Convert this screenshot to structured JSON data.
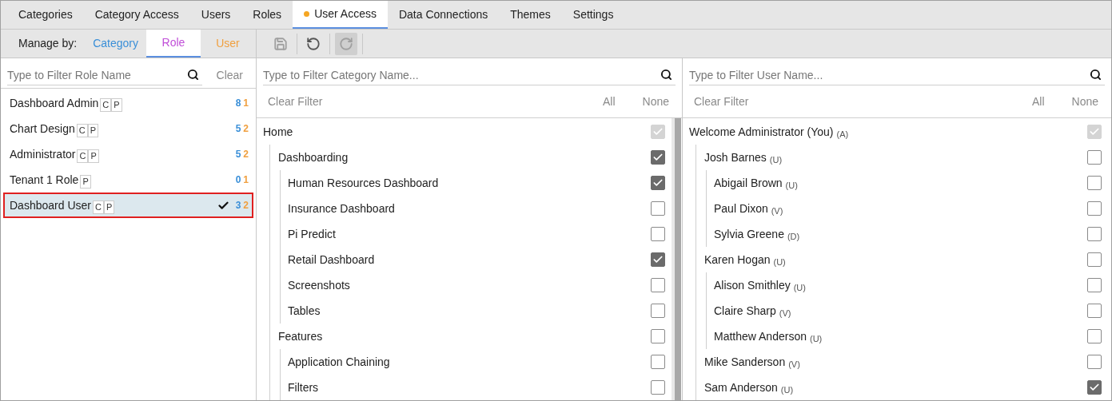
{
  "tabs": [
    {
      "label": "Categories",
      "selected": false,
      "modified": false
    },
    {
      "label": "Category Access",
      "selected": false,
      "modified": false
    },
    {
      "label": "Users",
      "selected": false,
      "modified": false
    },
    {
      "label": "Roles",
      "selected": false,
      "modified": false
    },
    {
      "label": "User Access",
      "selected": true,
      "modified": true
    },
    {
      "label": "Data Connections",
      "selected": false,
      "modified": false
    },
    {
      "label": "Themes",
      "selected": false,
      "modified": false
    },
    {
      "label": "Settings",
      "selected": false,
      "modified": false
    }
  ],
  "manage_by": {
    "label": "Manage by:",
    "options": [
      {
        "label": "Category",
        "selected": false,
        "color": "#3a8fd8"
      },
      {
        "label": "Role",
        "selected": true,
        "color": "#c04fd8"
      },
      {
        "label": "User",
        "selected": false,
        "color": "#f0a040"
      }
    ]
  },
  "toolbar": [
    {
      "kind": "save",
      "disabled": true,
      "pressed": false
    },
    {
      "kind": "undo",
      "disabled": false,
      "pressed": false
    },
    {
      "kind": "redo",
      "disabled": true,
      "pressed": true
    }
  ],
  "roles_panel": {
    "search": {
      "placeholder": "Type to Filter Role Name"
    },
    "clear": "Clear",
    "roles": [
      {
        "name": "Dashboard Admin",
        "badges": [
          "C",
          "P"
        ],
        "count_a": "8",
        "count_b": "1",
        "selected": false
      },
      {
        "name": "Chart Design",
        "badges": [
          "C",
          "P"
        ],
        "count_a": "5",
        "count_b": "2",
        "selected": false
      },
      {
        "name": "Administrator",
        "badges": [
          "C",
          "P"
        ],
        "count_a": "5",
        "count_b": "2",
        "selected": false
      },
      {
        "name": "Tenant 1 Role",
        "badges": [
          "P"
        ],
        "count_a": "0",
        "count_b": "1",
        "selected": false
      },
      {
        "name": "Dashboard User",
        "badges": [
          "C",
          "P"
        ],
        "count_a": "3",
        "count_b": "2",
        "selected": true
      }
    ]
  },
  "categories_panel": {
    "search": {
      "placeholder": "Type to Filter Category Name..."
    },
    "clear_filter": "Clear Filter",
    "all": "All",
    "none": "None",
    "items": [
      {
        "name": "Home",
        "checked": true,
        "disabled": true,
        "children": [
          {
            "name": "Dashboarding",
            "checked": true,
            "disabled": false,
            "children": [
              {
                "name": "Human Resources Dashboard",
                "checked": true,
                "disabled": false
              },
              {
                "name": "Insurance Dashboard",
                "checked": false,
                "disabled": false
              },
              {
                "name": "Pi Predict",
                "checked": false,
                "disabled": false
              },
              {
                "name": "Retail Dashboard",
                "checked": true,
                "disabled": false
              },
              {
                "name": "Screenshots",
                "checked": false,
                "disabled": false
              },
              {
                "name": "Tables",
                "checked": false,
                "disabled": false
              }
            ]
          },
          {
            "name": "Features",
            "checked": false,
            "disabled": false,
            "children": [
              {
                "name": "Application Chaining",
                "checked": false,
                "disabled": false
              },
              {
                "name": "Filters",
                "checked": false,
                "disabled": false
              }
            ]
          }
        ]
      }
    ]
  },
  "users_panel": {
    "search": {
      "placeholder": "Type to Filter User Name..."
    },
    "clear_filter": "Clear Filter",
    "all": "All",
    "none": "None",
    "items": [
      {
        "name": "Welcome Administrator (You)",
        "type": "(A)",
        "checked": true,
        "disabled": true,
        "children": [
          {
            "name": "Josh Barnes",
            "type": "(U)",
            "checked": false,
            "disabled": false,
            "children": [
              {
                "name": "Abigail Brown",
                "type": "(U)",
                "checked": false,
                "disabled": false
              },
              {
                "name": "Paul Dixon",
                "type": "(V)",
                "checked": false,
                "disabled": false
              },
              {
                "name": "Sylvia Greene",
                "type": "(D)",
                "checked": false,
                "disabled": false
              }
            ]
          },
          {
            "name": "Karen Hogan",
            "type": "(U)",
            "checked": false,
            "disabled": false,
            "children": [
              {
                "name": "Alison Smithley",
                "type": "(U)",
                "checked": false,
                "disabled": false
              },
              {
                "name": "Claire Sharp",
                "type": "(V)",
                "checked": false,
                "disabled": false
              },
              {
                "name": "Matthew Anderson",
                "type": "(U)",
                "checked": false,
                "disabled": false
              }
            ]
          },
          {
            "name": "Mike Sanderson",
            "type": "(V)",
            "checked": false,
            "disabled": false
          },
          {
            "name": "Sam Anderson",
            "type": "(U)",
            "checked": true,
            "disabled": false
          }
        ]
      }
    ]
  }
}
